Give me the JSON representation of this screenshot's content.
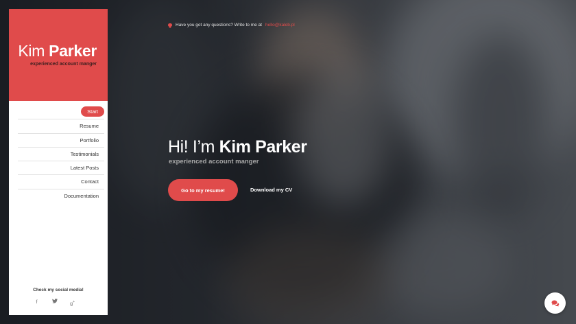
{
  "sidebar": {
    "brand_first": "Kim",
    "brand_last": "Parker",
    "tagline": "experienced account manger",
    "nav": [
      {
        "label": "Start",
        "active": true
      },
      {
        "label": "Resume"
      },
      {
        "label": "Portfolio"
      },
      {
        "label": "Testimonials"
      },
      {
        "label": "Latest Posts"
      },
      {
        "label": "Contact"
      },
      {
        "label": "Documentation"
      }
    ],
    "social_title": "Check my social media!",
    "social_icons": [
      "facebook-icon",
      "twitter-icon",
      "google-plus-icon"
    ]
  },
  "topbar": {
    "text": "Have you got any questions? Write to me at",
    "email": "hello@kaleb.pl"
  },
  "hero": {
    "greeting": "Hi! I’m",
    "name": "Kim Parker",
    "subtitle": "experienced account manger",
    "resume_button": "Go to my resume!",
    "cv_link": "Download my CV"
  },
  "colors": {
    "accent": "#e04b4b",
    "sidebar_bg": "#ffffff",
    "text_dark": "#333333"
  }
}
